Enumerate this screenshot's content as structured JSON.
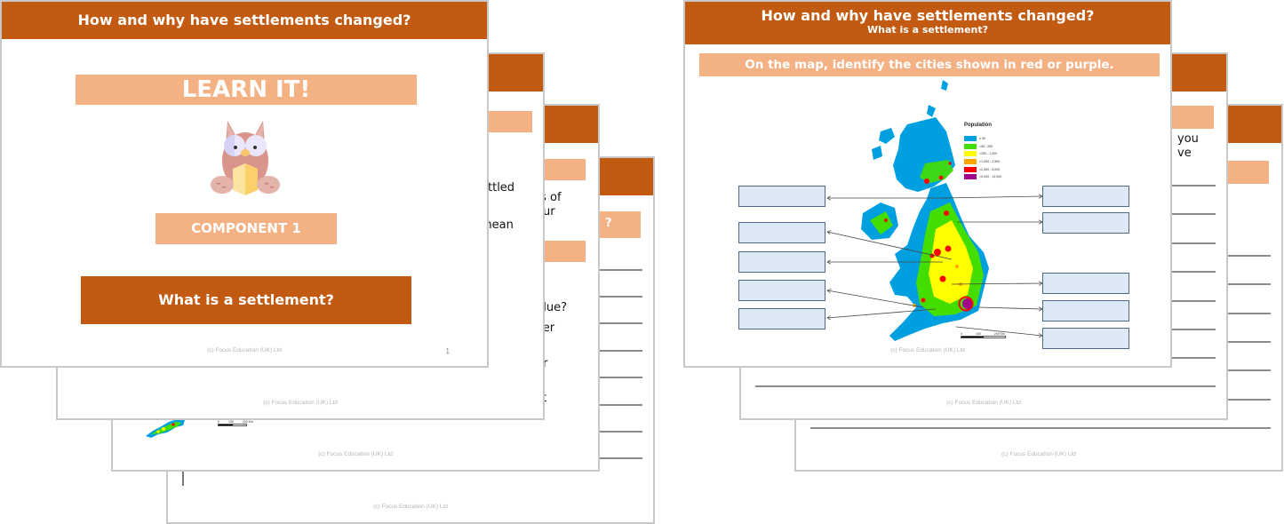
{
  "colors": {
    "header_brown": "#c35a12",
    "pill_peach": "#f3b184",
    "answer_box_fill": "#dce8f4",
    "answer_box_border": "#4d6a8a"
  },
  "left_stack": {
    "slide1": {
      "header": "How and why have settlements changed?",
      "learn_label": "LEARN IT!",
      "owl_icon": "owl-reading-book-icon",
      "component_label": "COMPONENT 1",
      "topic_label": "What is a settlement?",
      "footer": "(c) Focus Education (UK) Ltd",
      "page_number": "1"
    },
    "slide2": {
      "text_fragments": [
        "ettled",
        "mean",
        "e"
      ],
      "footer": "(c) Focus Education (UK) Ltd"
    },
    "slide3": {
      "text_fragments": [
        "ts of",
        "our",
        "blue?",
        "ver",
        "or",
        "ct"
      ],
      "scale_labels": [
        "0",
        "100",
        "200 Km"
      ],
      "footer": "(c) Focus Education (UK) Ltd"
    },
    "slide4": {
      "text_fragments": [
        "?"
      ],
      "footer": "(c) Focus Education (UK) Ltd"
    }
  },
  "right_stack": {
    "slide1": {
      "header": "How and why have settlements changed?",
      "subheader": "What is a settlement?",
      "instruction": "On the map, identify the cities shown in red or purple.",
      "legend": {
        "title": "Population",
        "items": [
          {
            "label": "≤ 50",
            "color": "#00a0e0"
          },
          {
            "label": ">50 - 250",
            "color": "#44dd00"
          },
          {
            "label": ">250 - 1,000",
            "color": "#ffff00"
          },
          {
            "label": ">1,000 - 2,500",
            "color": "#ffa500"
          },
          {
            "label": ">2,500 - 5,000",
            "color": "#ff0000"
          },
          {
            "label": ">5,000 - 13,000",
            "color": "#a0008a"
          }
        ]
      },
      "scale_labels": [
        "0",
        "100",
        "200 Km"
      ],
      "answer_boxes_left": [
        "",
        "",
        "",
        "",
        ""
      ],
      "answer_boxes_right": [
        "",
        "",
        "",
        "",
        "",
        ""
      ],
      "footer": "(c) Focus Education (UK) Ltd"
    },
    "slide2": {
      "text_fragments": [
        "you",
        "ve"
      ],
      "footer": "(c) Focus Education (UK) Ltd"
    },
    "slide3": {
      "footer": "(c) Focus Education (UK) Ltd"
    }
  }
}
